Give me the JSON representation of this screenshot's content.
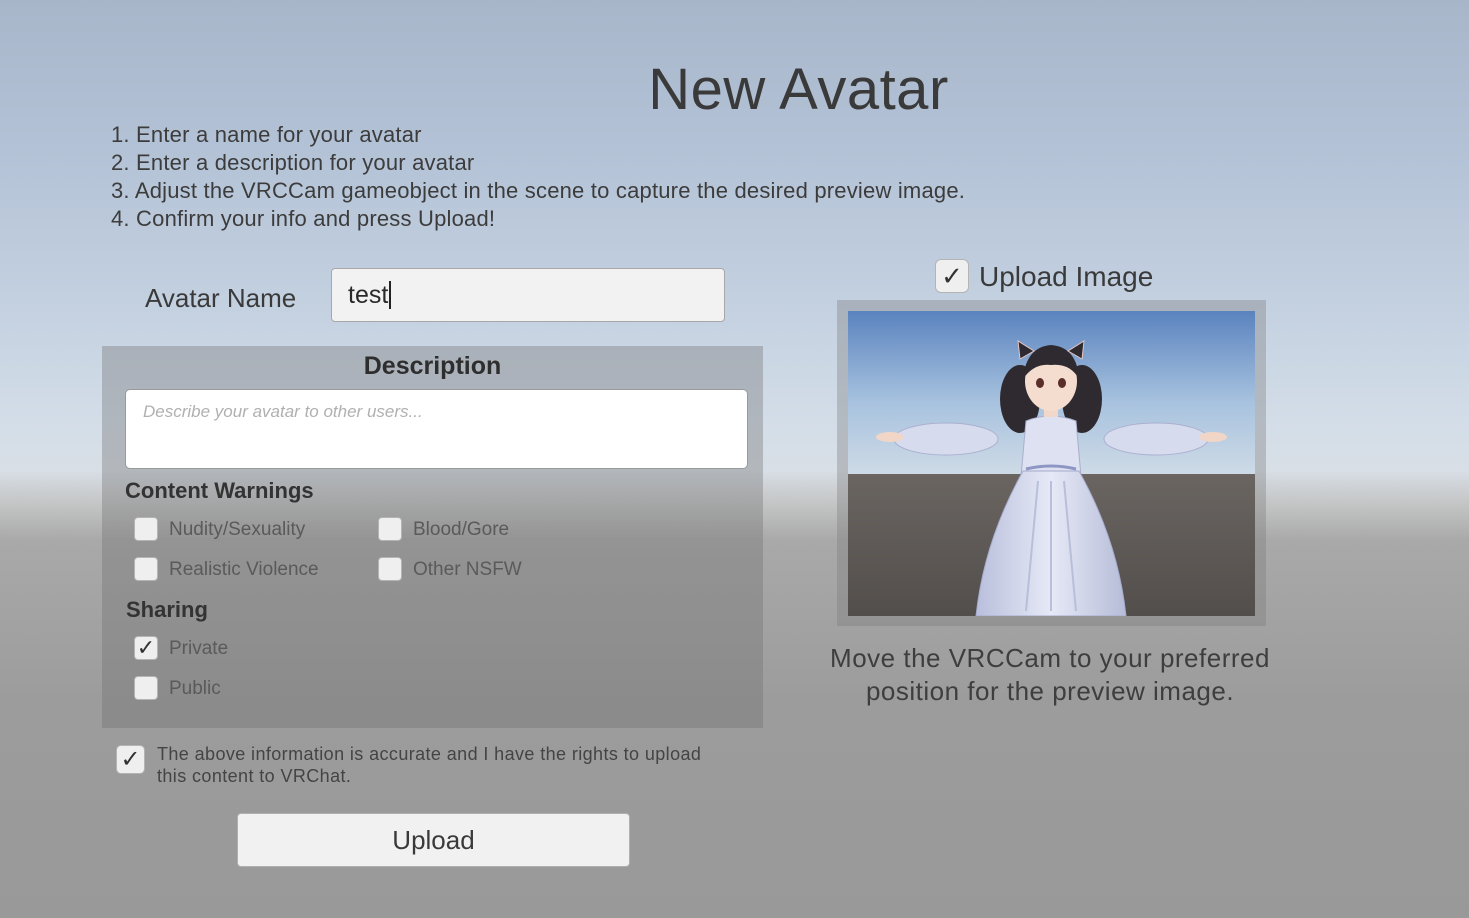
{
  "header": {
    "title": "New Avatar",
    "steps": [
      "1. Enter a name for your avatar",
      "2. Enter a description for your avatar",
      "3. Adjust the VRCCam gameobject in the scene to capture the desired preview image.",
      "4. Confirm your info and press Upload!"
    ]
  },
  "form": {
    "name_label": "Avatar Name",
    "name_value": "test",
    "description_title": "Description",
    "description_placeholder": "Describe your avatar to other users...",
    "content_warnings_label": "Content Warnings",
    "content_warnings": [
      {
        "label": "Nudity/Sexuality",
        "checked": false
      },
      {
        "label": "Blood/Gore",
        "checked": false
      },
      {
        "label": "Realistic Violence",
        "checked": false
      },
      {
        "label": "Other NSFW",
        "checked": false
      }
    ],
    "sharing_label": "Sharing",
    "sharing_options": [
      {
        "label": "Private",
        "checked": true
      },
      {
        "label": "Public",
        "checked": false
      }
    ],
    "accept_text": "The above information is accurate and I have the rights to upload this content to VRChat.",
    "accept_checked": true,
    "upload_label": "Upload"
  },
  "preview": {
    "upload_image_label": "Upload Image",
    "upload_image_checked": true,
    "caption": "Move the VRCCam to your preferred position for the preview image."
  },
  "icons": {
    "check": "check-icon"
  },
  "colors": {
    "sky_top": "#a8b6ca",
    "ground": "#999999",
    "preview_sky": "#93b3d8",
    "preview_ground": "#5c5753"
  }
}
